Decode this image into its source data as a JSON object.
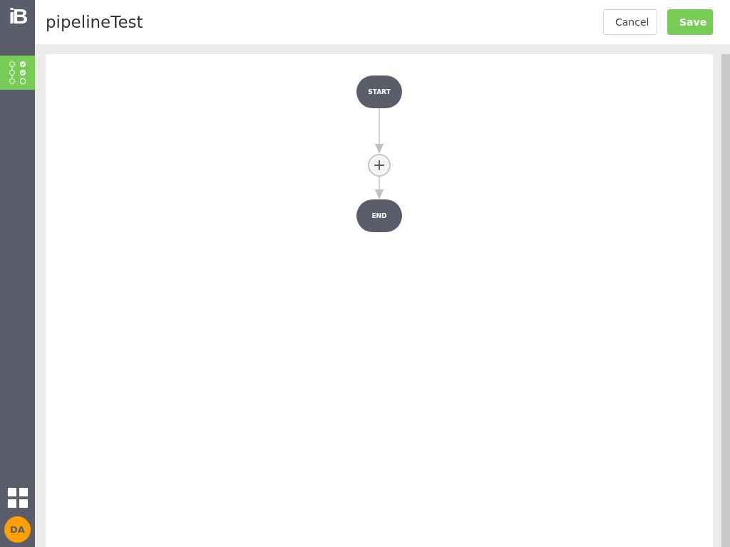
{
  "sidebar": {
    "logo": "iB",
    "items": [
      {
        "kind": "pipeline",
        "selected": true
      }
    ],
    "avatar": "DA"
  },
  "header": {
    "title": "pipelineTest",
    "buttons": [
      {
        "label": "Cancel",
        "kind": "secondary"
      },
      {
        "label": "Save",
        "kind": "primary"
      }
    ]
  },
  "pipeline": {
    "nodes": [
      {
        "kind": "terminal",
        "label": "START"
      },
      {
        "kind": "add"
      },
      {
        "kind": "terminal",
        "label": "END"
      }
    ]
  }
}
